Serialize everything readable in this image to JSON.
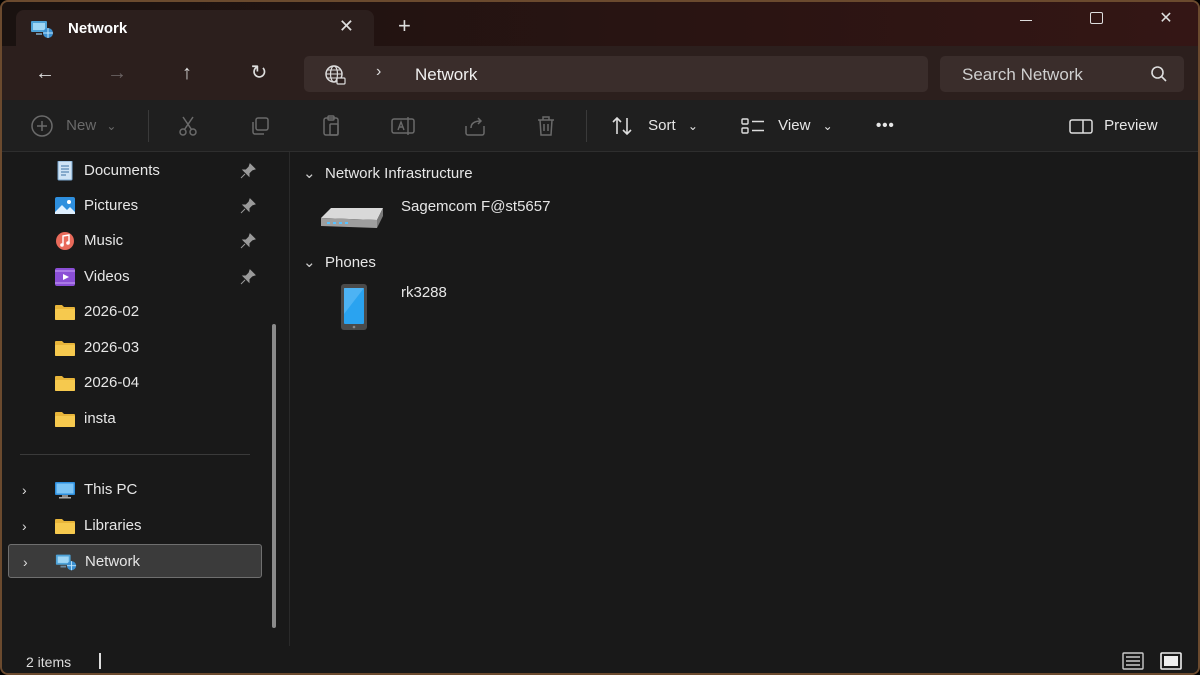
{
  "window": {
    "tab_title": "Network",
    "tab_close": "✕",
    "new_tab": "+",
    "close_symbol": "✕"
  },
  "address": {
    "back": "←",
    "forward": "→",
    "up": "↑",
    "refresh": "↻",
    "separator": "›",
    "path": "Network",
    "search_placeholder": "Search Network"
  },
  "toolbar": {
    "new_label": "New",
    "sort_label": "Sort",
    "view_label": "View",
    "more_label": "•••",
    "preview_label": "Preview",
    "dropdown_chevron": "⌄"
  },
  "sidebar": {
    "quick_access": [
      {
        "label": "Documents",
        "icon": "documents-icon",
        "pinned": true
      },
      {
        "label": "Pictures",
        "icon": "pictures-icon",
        "pinned": true
      },
      {
        "label": "Music",
        "icon": "music-icon",
        "pinned": true
      },
      {
        "label": "Videos",
        "icon": "videos-icon",
        "pinned": true
      },
      {
        "label": "2026-02",
        "icon": "folder-icon",
        "pinned": false
      },
      {
        "label": "2026-03",
        "icon": "folder-icon",
        "pinned": false
      },
      {
        "label": "2026-04",
        "icon": "folder-icon",
        "pinned": false
      },
      {
        "label": "insta",
        "icon": "folder-icon",
        "pinned": false
      }
    ],
    "locations": [
      {
        "label": "This PC",
        "icon": "this-pc-icon",
        "expand": "›",
        "selected": false
      },
      {
        "label": "Libraries",
        "icon": "libraries-icon",
        "expand": "›",
        "selected": false
      },
      {
        "label": "Network",
        "icon": "network-icon",
        "expand": "›",
        "selected": true
      }
    ]
  },
  "content": {
    "groups": [
      {
        "header": "Network Infrastructure",
        "chevron": "⌄",
        "items": [
          {
            "label": "Sagemcom F@st5657",
            "icon": "router-icon"
          }
        ]
      },
      {
        "header": "Phones",
        "chevron": "⌄",
        "items": [
          {
            "label": "rk3288",
            "icon": "phone-icon"
          }
        ]
      }
    ]
  },
  "status": {
    "item_count": "2 items"
  },
  "colors": {
    "accent": "#4cc2ff",
    "folder": "#f6c94e",
    "selected_bg": "#3b3b3b"
  }
}
